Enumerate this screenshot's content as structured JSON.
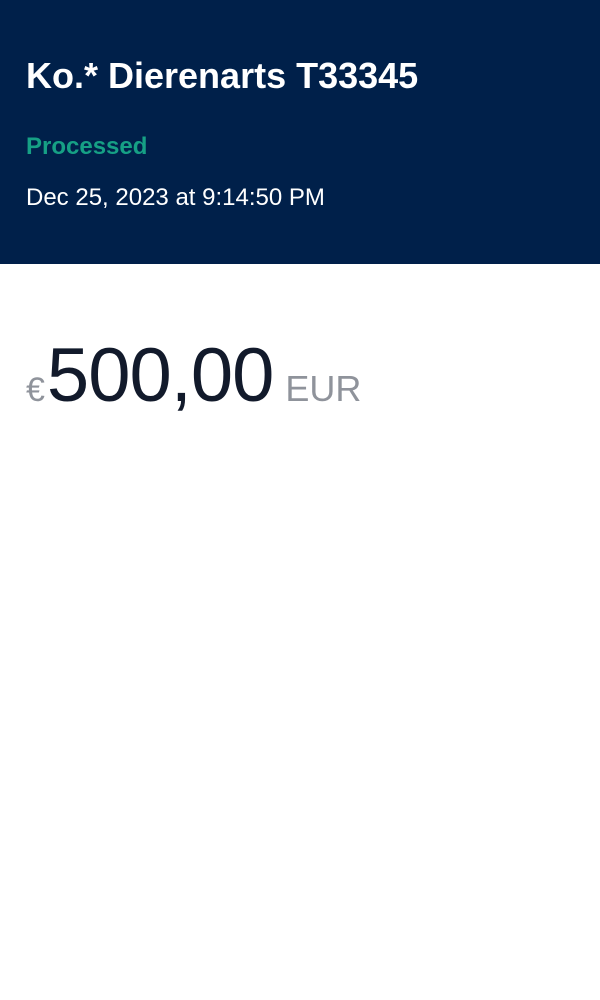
{
  "transaction": {
    "merchant_name": "Ko.* Dierenarts T33345",
    "status": "Processed",
    "timestamp": "Dec 25, 2023 at 9:14:50 PM",
    "amount": {
      "symbol": "€",
      "value": "500,00",
      "currency": "EUR"
    }
  },
  "colors": {
    "header_background": "#00204a",
    "status_text": "#16a085",
    "amount_text": "#121a2b",
    "muted_text": "#8f939b"
  }
}
